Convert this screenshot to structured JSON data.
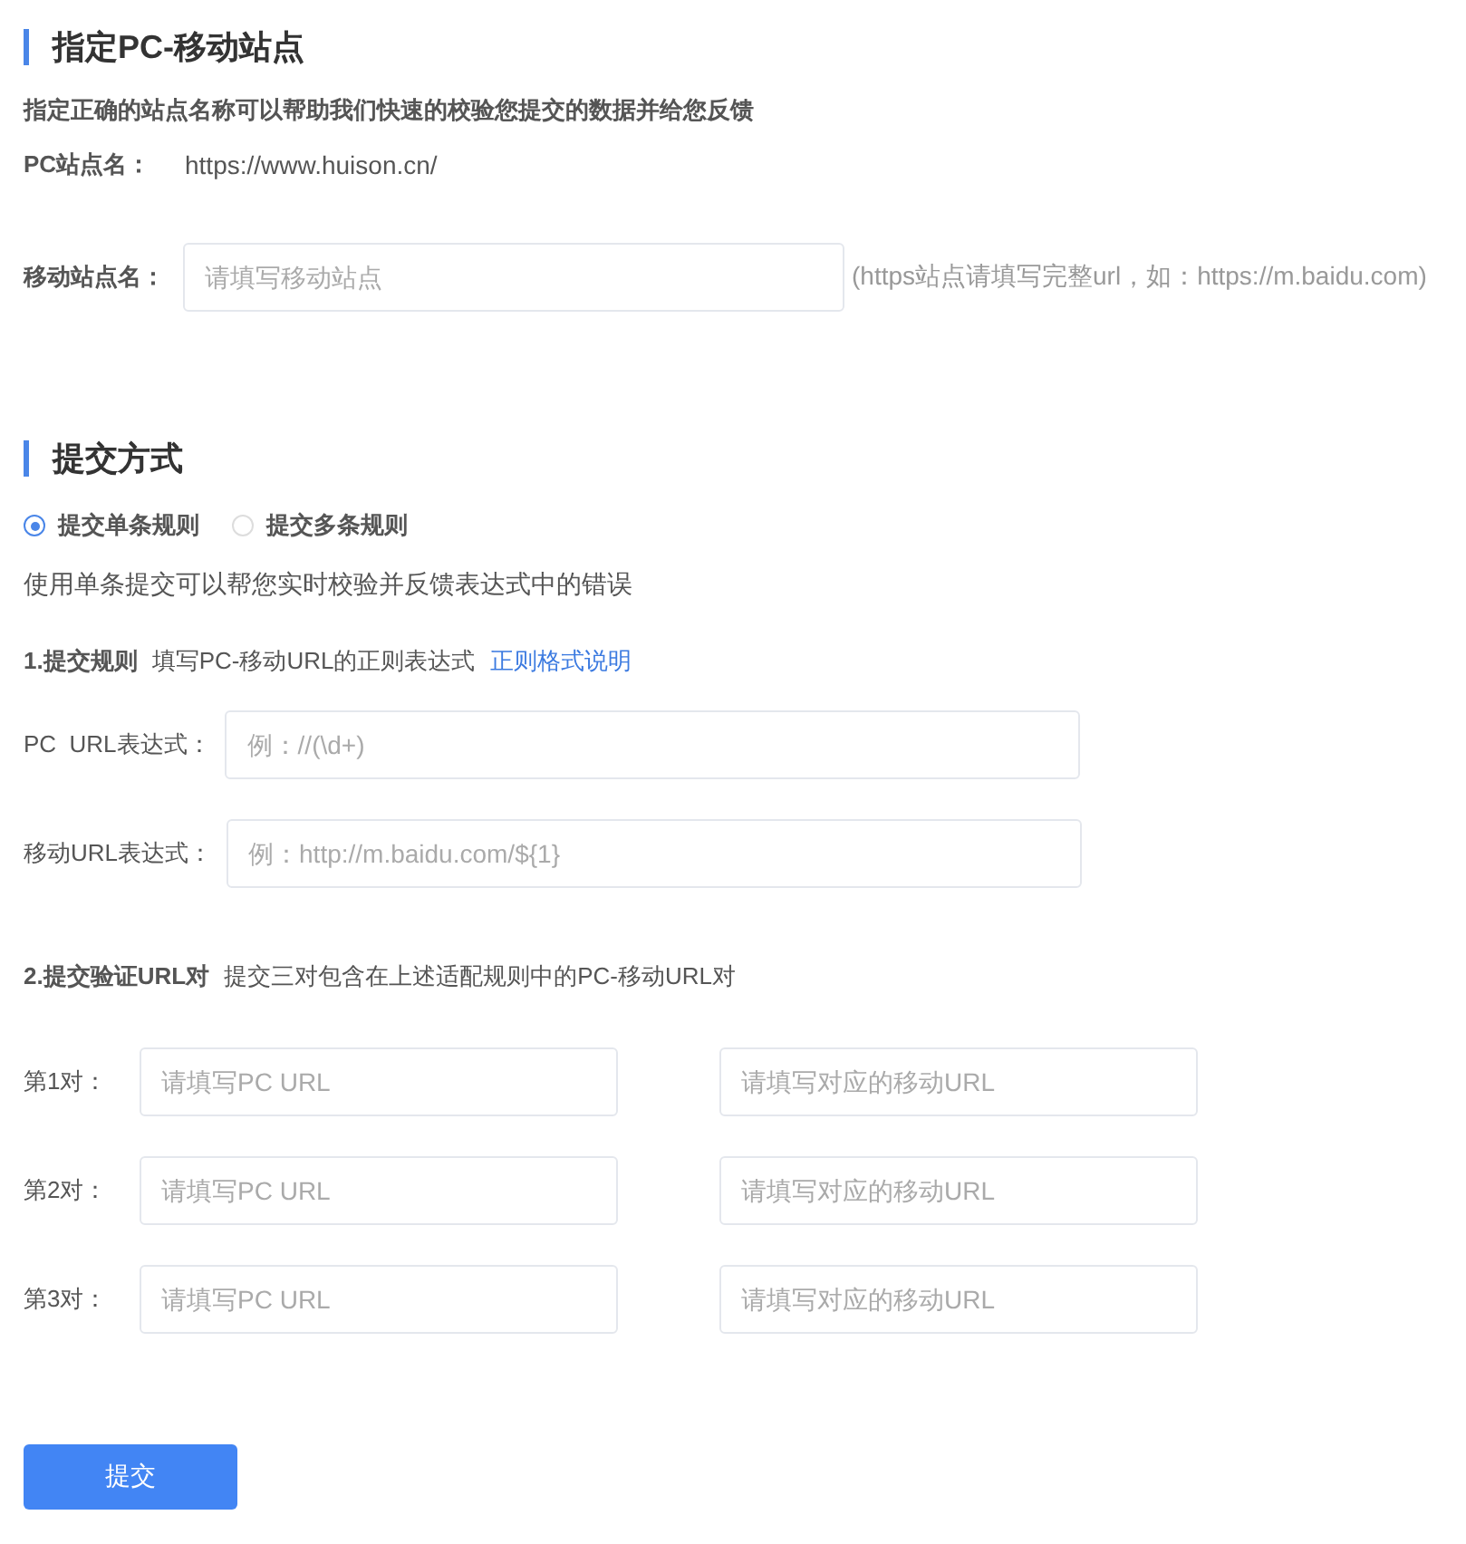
{
  "site_section": {
    "title": "指定PC-移动站点",
    "description": "指定正确的站点名称可以帮助我们快速的校验您提交的数据并给您反馈",
    "pc_site": {
      "label": "PC站点名：",
      "value": "https://www.huison.cn/"
    },
    "mobile_site": {
      "label": "移动站点名：",
      "placeholder": "请填写移动站点",
      "hint": "(https站点请填写完整url，如：https://m.baidu.com)"
    }
  },
  "submit_section": {
    "title": "提交方式",
    "modes": [
      {
        "label": "提交单条规则",
        "selected": true
      },
      {
        "label": "提交多条规则",
        "selected": false
      }
    ],
    "note": "使用单条提交可以帮您实时校验并反馈表达式中的错误",
    "step1": {
      "title": "1.提交规则",
      "description": "填写PC-移动URL的正则表达式",
      "link": "正则格式说明"
    },
    "rule_fields": [
      {
        "label": "PC  URL表达式：",
        "placeholder": "例：//(\\d+)"
      },
      {
        "label": "移动URL表达式：",
        "placeholder": "例：http://m.baidu.com/${1}"
      }
    ],
    "step2": {
      "title": "2.提交验证URL对",
      "description": "提交三对包含在上述适配规则中的PC-移动URL对"
    },
    "pairs": [
      {
        "label": "第1对：",
        "pc_placeholder": "请填写PC URL",
        "mobile_placeholder": "请填写对应的移动URL"
      },
      {
        "label": "第2对：",
        "pc_placeholder": "请填写PC URL",
        "mobile_placeholder": "请填写对应的移动URL"
      },
      {
        "label": "第3对：",
        "pc_placeholder": "请填写PC URL",
        "mobile_placeholder": "请填写对应的移动URL"
      }
    ]
  },
  "submit_button": "提交"
}
